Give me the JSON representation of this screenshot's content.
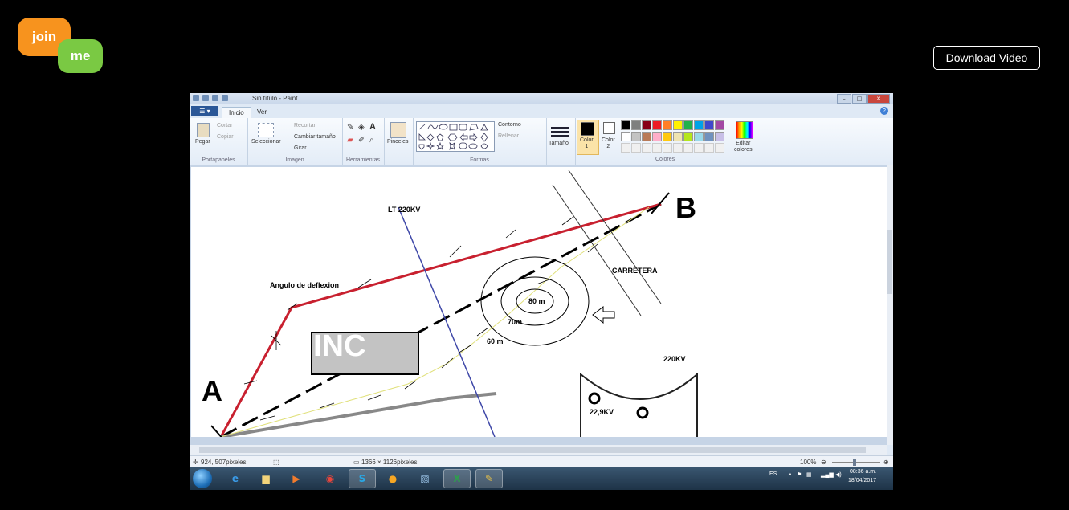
{
  "brand": {
    "logo_top": "join",
    "logo_bottom": "me"
  },
  "download_button": "Download Video",
  "paint": {
    "window_title": "Sin título - Paint",
    "tabs": [
      "Inicio",
      "Ver"
    ],
    "ribbon": {
      "portapapeles": {
        "pegar": "Pegar",
        "cortar": "Cortar",
        "copiar": "Copiar",
        "group": "Portapapeles"
      },
      "imagen": {
        "seleccionar": "Seleccionar",
        "recortar": "Recortar",
        "cambiar": "Cambiar tamaño",
        "girar": "Girar",
        "group": "Imagen"
      },
      "herramientas": {
        "group": "Herramientas"
      },
      "pinceles": "Pinceles",
      "formas": {
        "contorno": "Contorno",
        "rellenar": "Rellenar",
        "group": "Formas"
      },
      "tamano": "Tamaño",
      "color1": "Color\n1",
      "color2": "Color\n2",
      "editar_colores": "Editar\ncolores",
      "colores_group": "Colores"
    },
    "palette": [
      "#000000",
      "#7f7f7f",
      "#880015",
      "#ed1c24",
      "#ff7f27",
      "#fff200",
      "#22b14c",
      "#00a2e8",
      "#3f48cc",
      "#a349a4",
      "#ffffff",
      "#c3c3c3",
      "#b97a57",
      "#ffaec9",
      "#ffc90e",
      "#efe4b0",
      "#b5e61d",
      "#99d9ea",
      "#7092be",
      "#c8bfe7"
    ],
    "drawing": {
      "label_a": "A",
      "label_b": "B",
      "inc": "INC",
      "lt": "LT 220KV",
      "angulo": "Angulo de deflexion",
      "carretera": "CARRETERA",
      "c80": "80 m",
      "c70": "70m",
      "c60": "60 m",
      "kv220": "220KV",
      "kv229": "22,9KV"
    },
    "status": {
      "pos": "924, 507píxeles",
      "size": "1366 × 1126píxeles",
      "zoom": "100%"
    }
  },
  "taskbar": {
    "lang": "ES",
    "time": "08:36 a.m.",
    "date": "18/04/2017"
  }
}
